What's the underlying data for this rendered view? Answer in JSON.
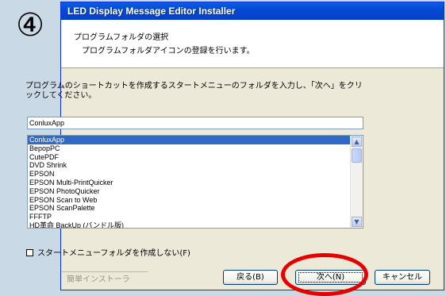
{
  "step_badge": "④",
  "window": {
    "title": "LED Display Message Editor Installer"
  },
  "header": {
    "title": "プログラムフォルダの選択",
    "subtitle": "プログラムフォルダアイコンの登録を行います。"
  },
  "instructions": "プログラムのショートカットを作成するスタートメニューのフォルダを入力し、「次へ」をクリックしてください。",
  "folder_input": {
    "value": "ConluxApp"
  },
  "folder_list": {
    "selected": "ConluxApp",
    "items": [
      "ConluxApp",
      "BepopPC",
      "CutePDF",
      "DVD Shrink",
      "EPSON",
      "EPSON Multi-PrintQuicker",
      "EPSON PhotoQuicker",
      "EPSON Scan to Web",
      "EPSON ScanPalette",
      "FFFTP",
      "HD革命 BackUp (バンドル版)"
    ]
  },
  "checkbox": {
    "label": "スタートメニューフォルダを作成しない(F)",
    "checked": false
  },
  "footer": {
    "label": "簡単インストーラ"
  },
  "buttons": {
    "back": "戻る(B)",
    "next": "次へ(N)",
    "cancel": "キャンセル"
  },
  "colors": {
    "titlebar": "#0649d4",
    "selection": "#316ac5",
    "highlight": "#e60000",
    "background": "#c9d9e5"
  }
}
